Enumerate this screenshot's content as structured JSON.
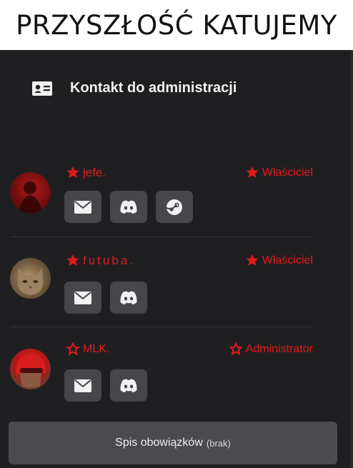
{
  "header": {
    "title": "PRZYSZŁOŚĆ KATUJEMY"
  },
  "section": {
    "title": "Kontakt do administracji",
    "icon": "contact-card-icon"
  },
  "members": [
    {
      "name": "jefe.",
      "role": "Właściciel",
      "buttons": [
        "mail-icon",
        "discord-icon",
        "steam-icon"
      ]
    },
    {
      "name": "futuba.",
      "role": "Właściciel",
      "buttons": [
        "mail-icon",
        "discord-icon"
      ]
    },
    {
      "name": "MLK.",
      "role": "Administrator",
      "buttons": [
        "mail-icon",
        "discord-icon"
      ]
    }
  ],
  "footer": {
    "label": "Spis obowiązków",
    "note": "(brak)"
  },
  "colors": {
    "accent_red": "#e01b1b",
    "background": "#1f1f22",
    "button": "#46464b"
  }
}
